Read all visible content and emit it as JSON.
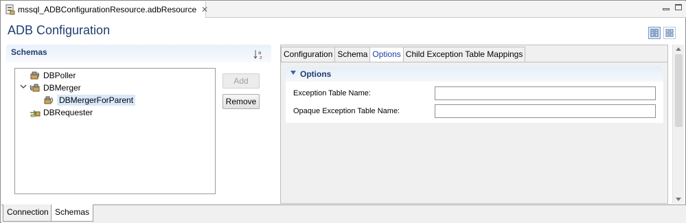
{
  "editor": {
    "tab_title": "mssql_ADBConfigurationResource.adbResource",
    "close_glyph": "✕"
  },
  "header": {
    "title": "ADB Configuration"
  },
  "schemas": {
    "title": "Schemas",
    "sort_icon": "sort-alpha-icon",
    "tree": [
      {
        "label": "DBPoller",
        "icon": "poller-icon",
        "level": 0,
        "expanded": null,
        "selected": false
      },
      {
        "label": "DBMerger",
        "icon": "merger-icon",
        "level": 0,
        "expanded": true,
        "selected": false
      },
      {
        "label": "DBMergerForParent",
        "icon": "merger-child-icon",
        "level": 1,
        "expanded": null,
        "selected": true
      },
      {
        "label": "DBRequester",
        "icon": "requester-icon",
        "level": 0,
        "expanded": null,
        "selected": false
      }
    ],
    "add_label": "Add",
    "add_enabled": false,
    "remove_label": "Remove"
  },
  "right_panel": {
    "tabs": [
      {
        "label": "Configuration",
        "active": false
      },
      {
        "label": "Schema",
        "active": false
      },
      {
        "label": "Options",
        "active": true
      },
      {
        "label": "Child Exception Table Mappings",
        "active": false
      }
    ],
    "options": {
      "title": "Options",
      "fields": [
        {
          "label": "Exception Table Name:",
          "value": ""
        },
        {
          "label": "Opaque Exception Table Name:",
          "value": ""
        }
      ]
    }
  },
  "bottom_tabs": [
    {
      "label": "Connection",
      "active": false
    },
    {
      "label": "Schemas",
      "active": true
    }
  ],
  "colors": {
    "title_blue": "#1f3d70",
    "active_tab_text": "#1b3fa6",
    "selection": "#d9e8fb"
  }
}
